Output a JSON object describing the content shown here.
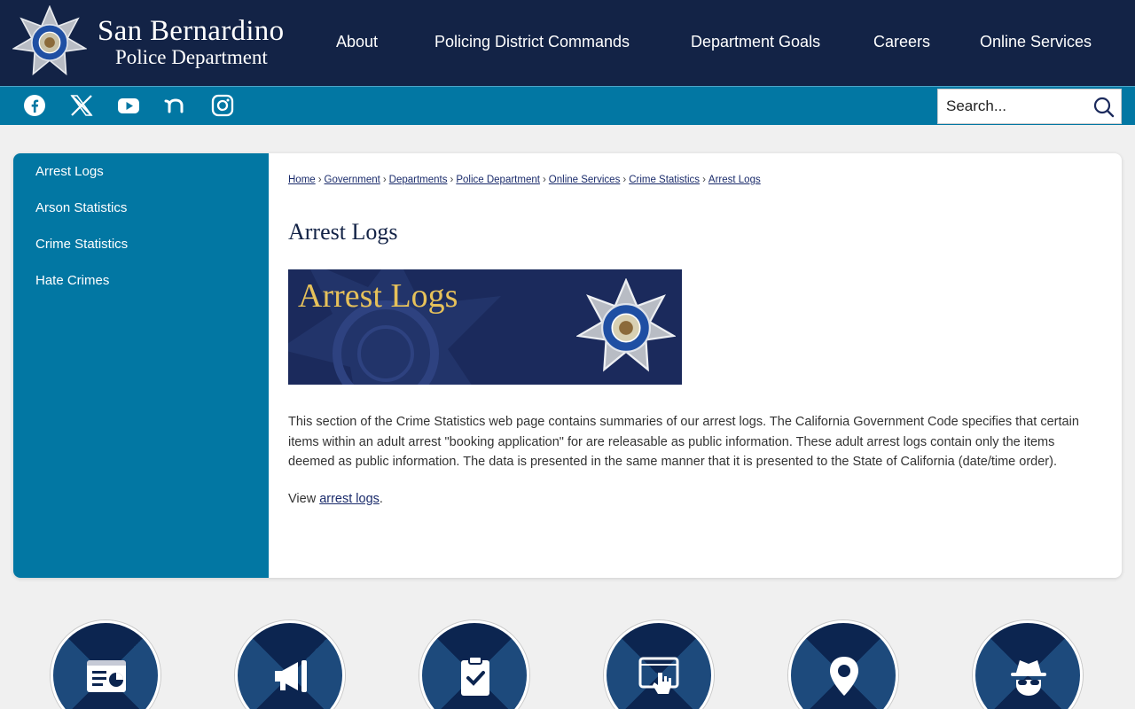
{
  "header": {
    "logo_line1": "San Bernardino",
    "logo_line2": "Police Department",
    "nav": [
      "About",
      "Policing District Commands",
      "Department Goals",
      "Careers",
      "Online Services"
    ]
  },
  "social": [
    "facebook-icon",
    "x-icon",
    "youtube-icon",
    "nextdoor-icon",
    "instagram-icon"
  ],
  "search": {
    "placeholder": "Search..."
  },
  "sidebar": {
    "items": [
      {
        "label": "Arrest Logs"
      },
      {
        "label": "Arson Statistics"
      },
      {
        "label": "Crime Statistics"
      },
      {
        "label": "Hate Crimes"
      }
    ]
  },
  "breadcrumb": [
    "Home",
    "Government",
    "Departments",
    "Police Department",
    "Online Services",
    "Crime Statistics",
    "Arrest Logs"
  ],
  "main": {
    "title": "Arrest Logs",
    "banner_title": "Arrest Logs",
    "body": "This section of the Crime Statistics web page contains summaries of our arrest logs. The California Government Code specifies that certain items within an adult arrest \"booking application\" for are releasable as public information. These adult arrest logs contain only the items deemed as public information. The data is presented in the same manner that it is presented to the State of California (date/time order).",
    "view_prefix": "View ",
    "view_link": "arrest logs",
    "view_suffix": "."
  },
  "quicklinks": [
    "chart-icon",
    "megaphone-icon",
    "clipboard-check-icon",
    "click-icon",
    "map-pin-icon",
    "detective-icon"
  ],
  "colors": {
    "navy": "#132346",
    "teal": "#0277a3",
    "gold": "#e6c15a"
  }
}
